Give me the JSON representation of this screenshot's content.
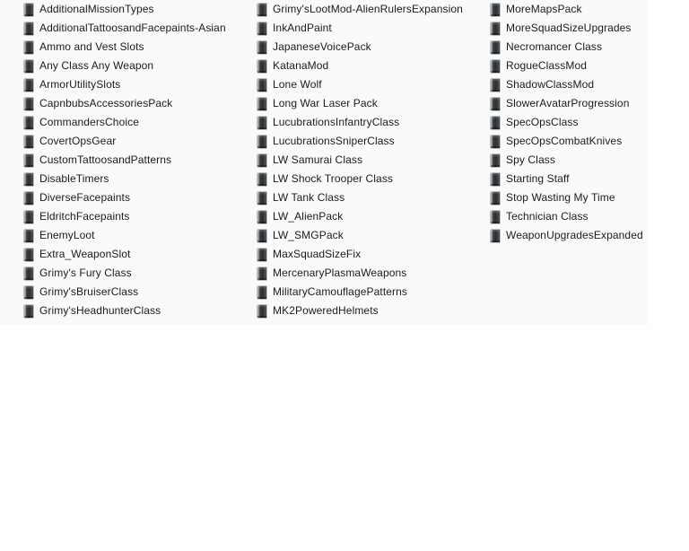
{
  "pane": {
    "name": "file-list-pane",
    "background_color": "#fafafa",
    "page_background_color": "#ffffff",
    "text_color": "#1b1b1b",
    "icon_name": "folder-icon",
    "view_mode": "list"
  },
  "columns": [
    {
      "index": 0,
      "items": [
        {
          "label": "AdditionalMissionTypes"
        },
        {
          "label": "AdditionalTattoosandFacepaints-Asian"
        },
        {
          "label": "Ammo and Vest Slots"
        },
        {
          "label": "Any Class Any Weapon"
        },
        {
          "label": "ArmorUtilitySlots"
        },
        {
          "label": "CapnbubsAccessoriesPack"
        },
        {
          "label": "CommandersChoice"
        },
        {
          "label": "CovertOpsGear"
        },
        {
          "label": "CustomTattoosandPatterns"
        },
        {
          "label": "DisableTimers"
        },
        {
          "label": "DiverseFacepaints"
        },
        {
          "label": "EldritchFacepaints"
        },
        {
          "label": "EnemyLoot"
        },
        {
          "label": "Extra_WeaponSlot"
        },
        {
          "label": "Grimy's Fury Class"
        },
        {
          "label": "Grimy'sBruiserClass"
        },
        {
          "label": "Grimy'sHeadhunterClass"
        }
      ]
    },
    {
      "index": 1,
      "items": [
        {
          "label": "Grimy'sLootMod-AlienRulersExpansion"
        },
        {
          "label": "InkAndPaint"
        },
        {
          "label": "JapaneseVoicePack"
        },
        {
          "label": "KatanaMod"
        },
        {
          "label": "Lone Wolf"
        },
        {
          "label": "Long War Laser Pack"
        },
        {
          "label": "LucubrationsInfantryClass"
        },
        {
          "label": "LucubrationsSniperClass"
        },
        {
          "label": "LW Samurai Class"
        },
        {
          "label": "LW Shock Trooper Class"
        },
        {
          "label": "LW Tank Class"
        },
        {
          "label": "LW_AlienPack"
        },
        {
          "label": "LW_SMGPack"
        },
        {
          "label": "MaxSquadSizeFix"
        },
        {
          "label": "MercenaryPlasmaWeapons"
        },
        {
          "label": "MilitaryCamouflagePatterns"
        },
        {
          "label": "MK2PoweredHelmets"
        }
      ]
    },
    {
      "index": 2,
      "items": [
        {
          "label": "MoreMapsPack"
        },
        {
          "label": "MoreSquadSizeUpgrades"
        },
        {
          "label": "Necromancer Class"
        },
        {
          "label": "RogueClassMod"
        },
        {
          "label": "ShadowClassMod"
        },
        {
          "label": "SlowerAvatarProgression"
        },
        {
          "label": "SpecOpsClass"
        },
        {
          "label": "SpecOpsCombatKnives"
        },
        {
          "label": "Spy Class"
        },
        {
          "label": "Starting Staff"
        },
        {
          "label": "Stop Wasting My Time"
        },
        {
          "label": "Technician Class"
        },
        {
          "label": "WeaponUpgradesExpanded"
        }
      ]
    }
  ]
}
